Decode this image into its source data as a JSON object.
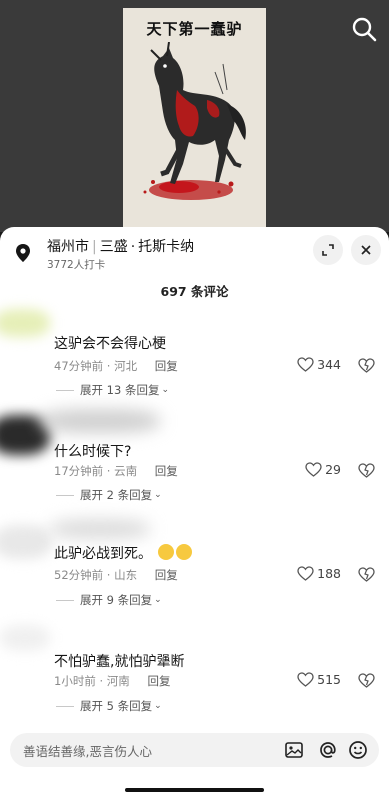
{
  "video": {
    "frame_title": "天下第一蠢驴"
  },
  "location": {
    "city": "福州市",
    "name_part1": "三盛",
    "name_part2": "托斯卡纳",
    "checkins": "3772人打卡"
  },
  "comments_header": "697 条评论",
  "comments": [
    {
      "text": "这驴会不会得心梗",
      "time": "47分钟前",
      "region": "河北",
      "reply": "回复",
      "likes": "344",
      "expand": "展开 13 条回复"
    },
    {
      "text": "什么时候下?",
      "time": "17分钟前",
      "region": "云南",
      "reply": "回复",
      "likes": "29",
      "expand": "展开 2 条回复"
    },
    {
      "text": "此驴必战到死。",
      "time": "52分钟前",
      "region": "山东",
      "reply": "回复",
      "likes": "188",
      "expand": "展开 9 条回复"
    },
    {
      "text": "不怕驴蠢,就怕驴犟断",
      "time": "1小时前",
      "region": "河南",
      "reply": "回复",
      "likes": "515",
      "expand": "展开 5 条回复"
    }
  ],
  "input": {
    "placeholder": "善语结善缘,恶言伤人心"
  }
}
